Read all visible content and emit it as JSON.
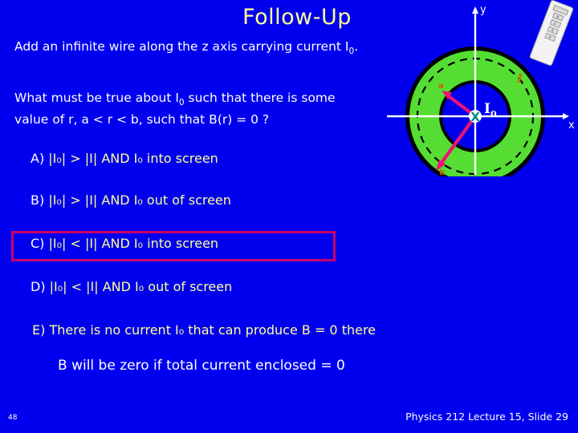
{
  "slide": {
    "title": "Follow-Up",
    "background_color": "#0000EE",
    "title_color": "#FFFF99",
    "body_color": "#FFFFFF",
    "highlight_color": "#CC0066"
  },
  "subtitle": {
    "text_before": "Add an infinite wire along the z axis carrying current I",
    "subscript": "0",
    "text_after": "."
  },
  "question": {
    "line1_a": "What must be true about I",
    "line1_sub": "0",
    "line1_b": " such that there is some",
    "line2": "value of r, a < r < b, such that B(r)  = 0 ?"
  },
  "options": [
    {
      "id": "A",
      "tag": "A)",
      "text": "|I₀| > |I|   AND   I₀ into screen",
      "highlighted": false
    },
    {
      "id": "B",
      "tag": "B)",
      "text": "|I₀| > |I|   AND   I₀ out of screen",
      "highlighted": false
    },
    {
      "id": "C",
      "tag": "C)",
      "text": "|I₀| < |I|   AND   I₀ into screen",
      "highlighted": true
    },
    {
      "id": "D",
      "tag": "D)",
      "text": "|I₀| < |I|   AND   I₀ out of screen",
      "highlighted": false
    },
    {
      "id": "E",
      "tag": "E)",
      "text": "There is no current I₀ that can produce B = 0 there",
      "highlighted": false
    }
  ],
  "conclusion": "B will be zero if total current enclosed = 0",
  "footer": {
    "slide_number_small": "48",
    "reference": "Physics 212 Lecture 15, Slide  29"
  },
  "diagram": {
    "axis_label_y": "y",
    "axis_label_x": "x",
    "center_label_I0": "I",
    "center_label_I0_sub": "0",
    "current_label_I": "I",
    "radius_label_inner": "a",
    "radius_label_outer": "b",
    "annulus_color": "#55DD33",
    "annulus_edge_color": "#000000",
    "arrow_color": "#EE1177",
    "axis_color": "#FFFFFF",
    "center_marker": "X",
    "center_marker_color": "#008888",
    "label_color_radius": "#CC6600",
    "dashed_circle": true
  },
  "clicker": {
    "keys": [
      "a",
      "c",
      "s",
      "x"
    ],
    "screen_label": ""
  }
}
